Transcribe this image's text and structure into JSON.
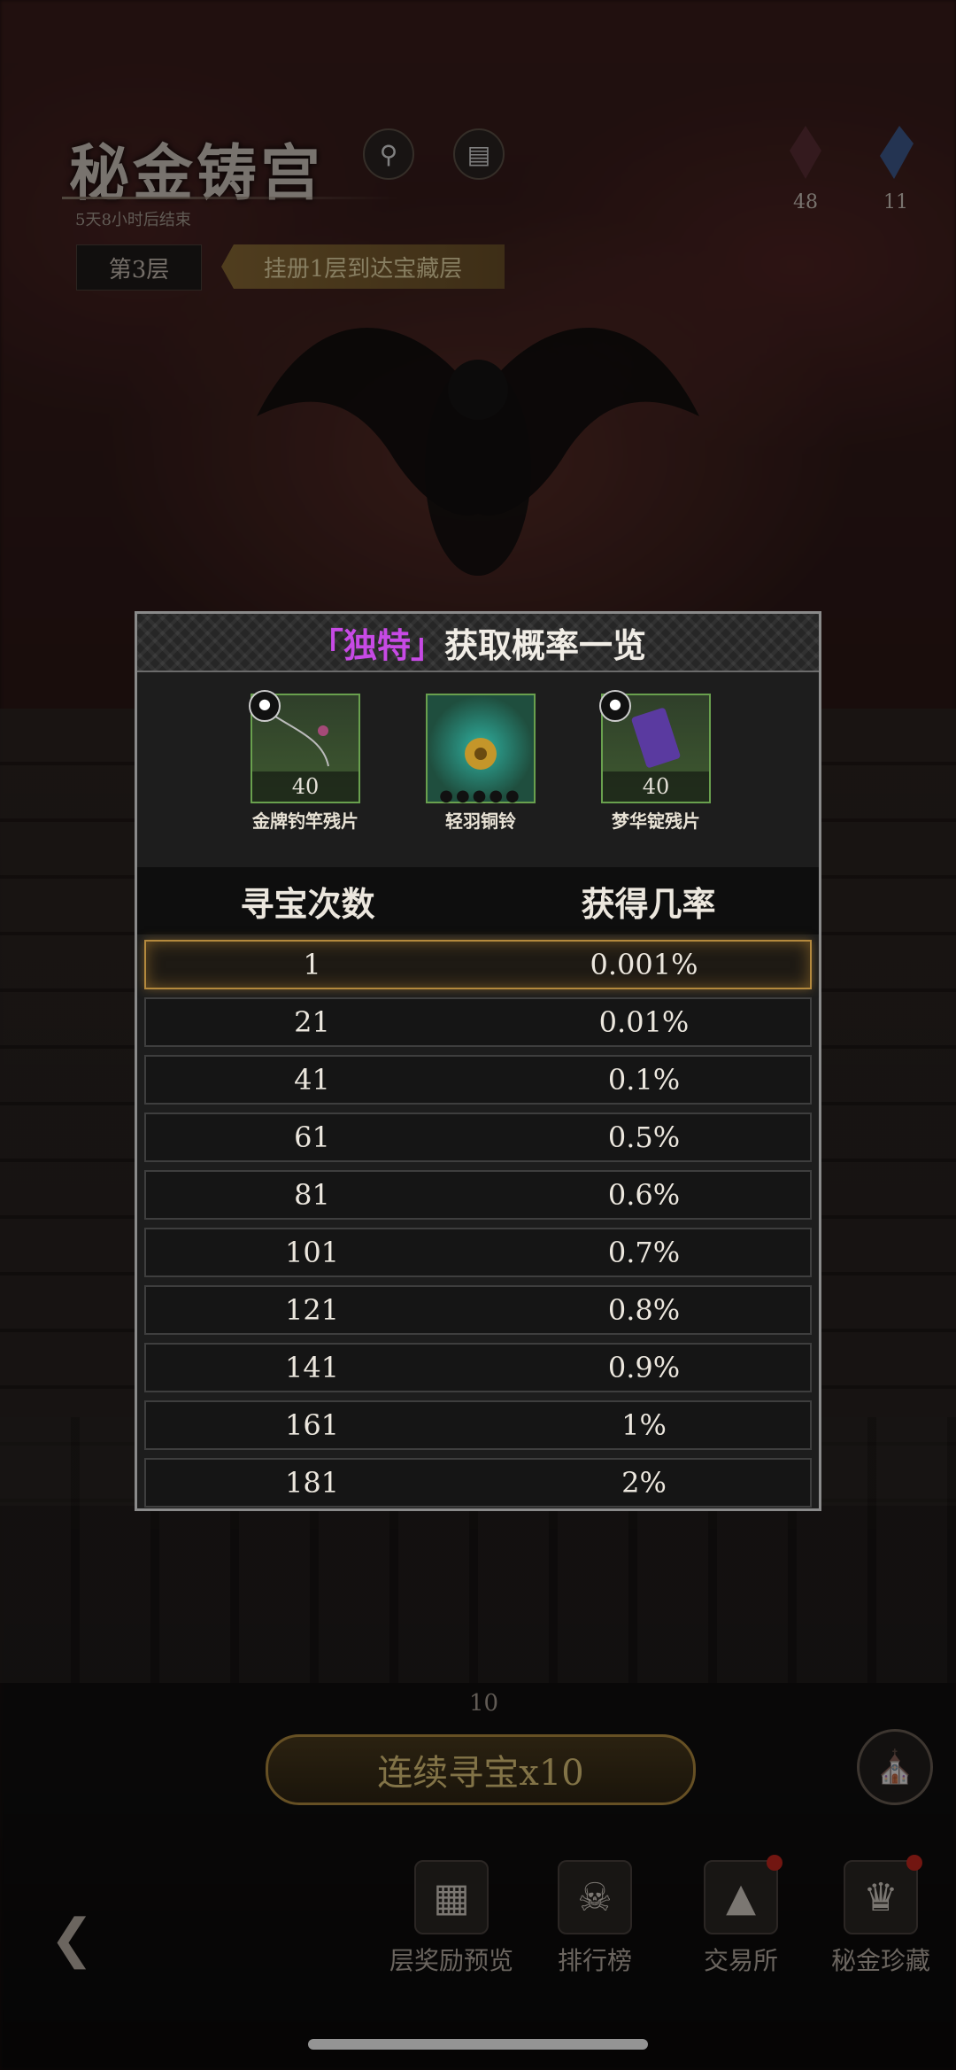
{
  "header": {
    "title": "秘金铸宫",
    "subtitle": "5天8小时后结束",
    "floor": "第3层",
    "floor_hint": "挂册1层到达宝藏层",
    "resources": [
      "48",
      "11"
    ]
  },
  "modal": {
    "title_open": "「",
    "title_highlight": "独特",
    "title_close": "」",
    "title_rest": "获取概率一览",
    "items": [
      {
        "name": "金牌钓竿残片",
        "qty": "40",
        "has_tag": true
      },
      {
        "name": "轻羽铜铃",
        "qty": "",
        "has_tag": false
      },
      {
        "name": "梦华锭残片",
        "qty": "40",
        "has_tag": true
      }
    ],
    "col_count": "寻宝次数",
    "col_rate": "获得几率",
    "rows": [
      {
        "count": "1",
        "rate": "0.001%",
        "active": true
      },
      {
        "count": "21",
        "rate": "0.01%"
      },
      {
        "count": "41",
        "rate": "0.1%"
      },
      {
        "count": "61",
        "rate": "0.5%"
      },
      {
        "count": "81",
        "rate": "0.6%"
      },
      {
        "count": "101",
        "rate": "0.7%"
      },
      {
        "count": "121",
        "rate": "0.8%"
      },
      {
        "count": "141",
        "rate": "0.9%"
      },
      {
        "count": "161",
        "rate": "1%"
      },
      {
        "count": "181",
        "rate": "2%"
      }
    ]
  },
  "bottom": {
    "count": "10",
    "ten_button": "连续寻宝x10",
    "nav": [
      "层奖励预览",
      "排行榜",
      "交易所",
      "秘金珍藏"
    ]
  },
  "colors": {
    "accent_purple": "#c74ae5",
    "gold": "#b4893d",
    "item_green": "#69a04e"
  }
}
